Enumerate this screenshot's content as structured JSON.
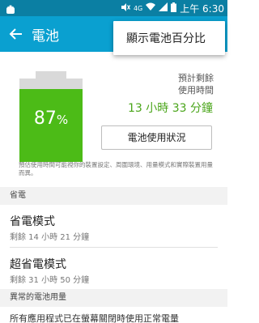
{
  "status_bar": {
    "time": "上午 6:30",
    "icons": [
      "android-notification-icon",
      "mute-icon",
      "network-type-icon",
      "wifi-icon",
      "signal-icon",
      "battery-icon"
    ],
    "network_label": "4G"
  },
  "app_bar": {
    "title": "電池",
    "back_icon": "arrow-left-icon"
  },
  "popup_menu": {
    "items": [
      "顯示電池百分比"
    ]
  },
  "battery": {
    "percent_value": "87",
    "percent_sign": "%",
    "level": 0.87,
    "fill_color": "#4cbb17"
  },
  "estimate": {
    "label_line1": "預計剩餘",
    "label_line2": "使用時間",
    "value": "13 小時 33 分鐘"
  },
  "usage_button": {
    "label": "電池使用狀況"
  },
  "note": "預估使用時間可能視你的裝置設定、周圍環境、用量模式和實際裝置用量而異。",
  "power_saving": {
    "header": "省電",
    "items": [
      {
        "title": "省電模式",
        "subtitle": "剩餘 14 小時 21 分鐘"
      },
      {
        "title": "超省電模式",
        "subtitle": "剩餘 31 小時 50 分鐘"
      }
    ]
  },
  "abnormal": {
    "header": "異常的電池用量",
    "text": "所有應用程式已在螢幕關閉時使用正常電量"
  },
  "colors": {
    "status_bar": "#0b7fa3",
    "app_bar": "#0aa0d0",
    "accent_green": "#4aa51a"
  }
}
